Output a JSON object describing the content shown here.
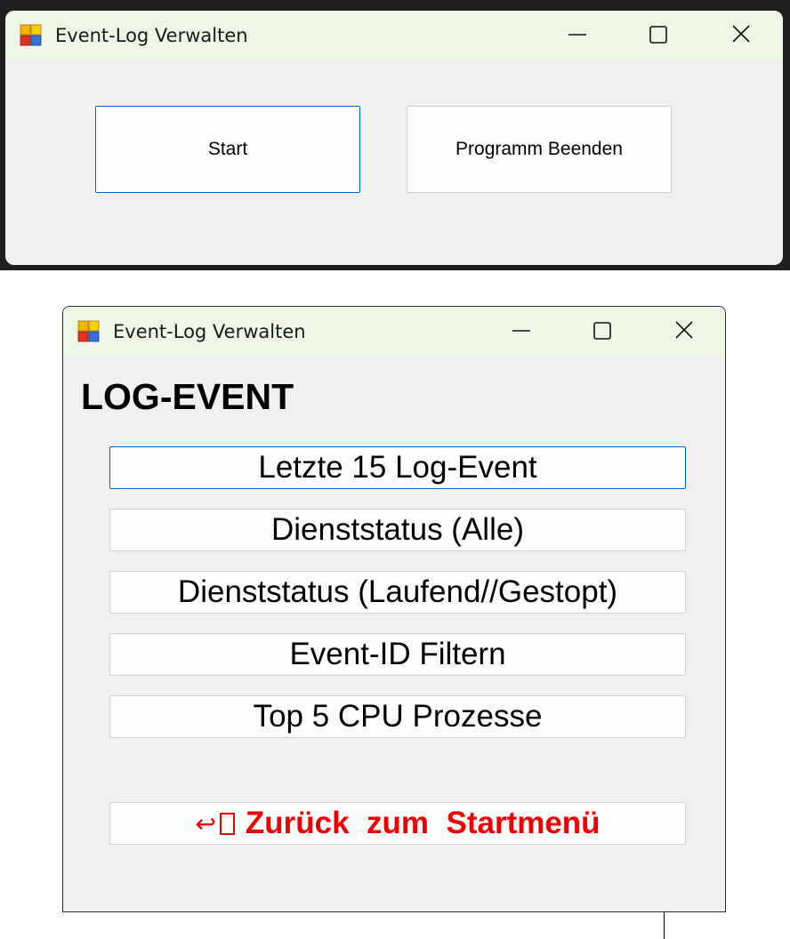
{
  "window1": {
    "title": "Event-Log Verwalten",
    "icon": "app-windows-icon",
    "buttons": {
      "start": "Start",
      "exit": "Programm Beenden"
    }
  },
  "window2": {
    "title": "Event-Log Verwalten",
    "icon": "app-windows-icon",
    "heading": "LOG-EVENT",
    "buttons": [
      {
        "label": "Letzte 15 Log-Event"
      },
      {
        "label": "Dienststatus (Alle)"
      },
      {
        "label": "Dienststatus (Laufend//Gestopt)"
      },
      {
        "label": "Event-ID Filtern"
      },
      {
        "label": "Top 5 CPU Prozesse"
      }
    ],
    "back": {
      "label": "Zurück  zum  Startmenü",
      "icon": "return-arrow-icon",
      "color": "#ee0000"
    }
  },
  "colors": {
    "titlebar": "#eef6e6",
    "client": "#f0f0f0",
    "focus_border": "#0064c8"
  }
}
